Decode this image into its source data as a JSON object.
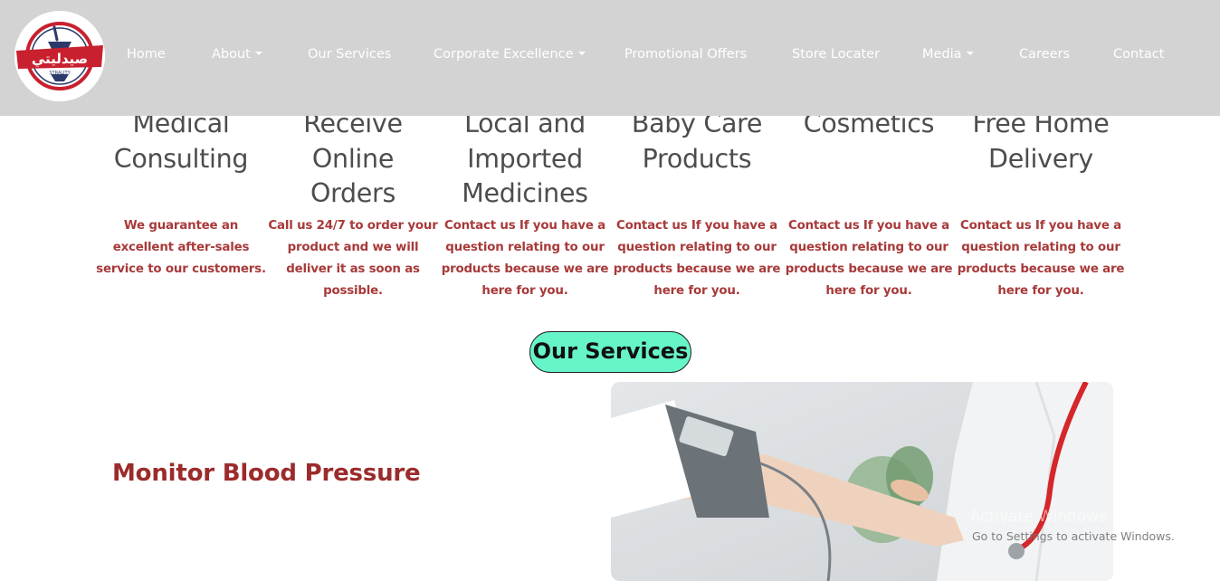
{
  "navbar": {
    "logo": {
      "text_ar": "صيدليتي",
      "text_en": "STRALITY"
    },
    "items": [
      {
        "label": "Home",
        "dropdown": false
      },
      {
        "label": "About",
        "dropdown": true
      },
      {
        "label": "Our Services",
        "dropdown": false
      },
      {
        "label": "Corporate Excellence",
        "dropdown": true
      },
      {
        "label": "Promotional Offers",
        "dropdown": false
      },
      {
        "label": "Store Locater",
        "dropdown": false
      },
      {
        "label": "Media",
        "dropdown": true
      },
      {
        "label": "Careers",
        "dropdown": false
      },
      {
        "label": "Contact",
        "dropdown": false
      }
    ]
  },
  "features": [
    {
      "title": "Medical Consulting",
      "description": "We guarantee an excellent after-sales service to our customers."
    },
    {
      "title": "Receive Online Orders",
      "description": "Call us 24/7 to order your product and we will deliver it as soon as possible."
    },
    {
      "title": "Local and Imported Medicines",
      "description": "Contact us If you have a question relating to our products because we are here for you."
    },
    {
      "title": "Baby Care Products",
      "description": "Contact us If you have a question relating to our products because we are here for you."
    },
    {
      "title": "Cosmetics",
      "description": "Contact us If you have a question relating to our products because we are here for you."
    },
    {
      "title": "Free Home Delivery",
      "description": "Contact us If you have a question relating to our products because we are here for you."
    }
  ],
  "services": {
    "heading": "Our Services",
    "items": [
      {
        "title": "Monitor Blood Pressure"
      }
    ]
  },
  "watermark": {
    "line1": "Activate Windows",
    "line2": "Go to Settings to activate Windows."
  },
  "colors": {
    "navbar_bg": "#d3d3d3",
    "feature_title": "#4d4d4d",
    "feature_desc": "#a83a3a",
    "services_pill": "#66f5c9",
    "service_title": "#9c2b2b",
    "brand_red": "#c8202f"
  }
}
